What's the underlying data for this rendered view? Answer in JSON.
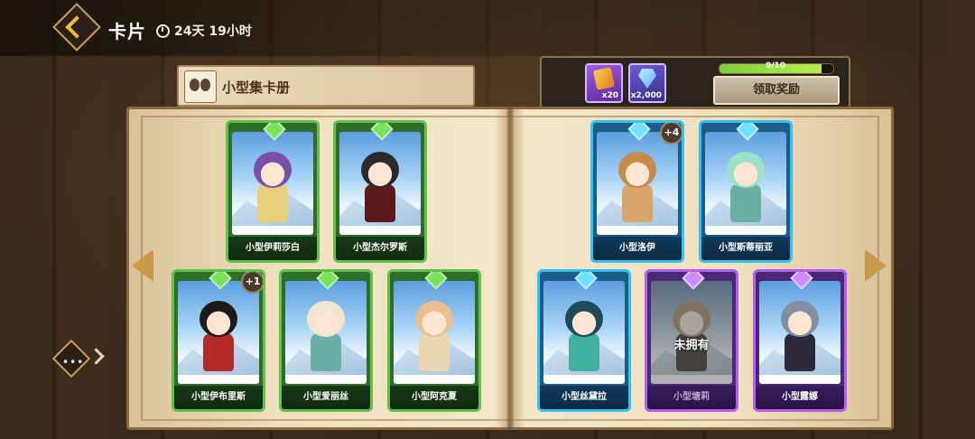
{
  "header": {
    "title": "卡片",
    "timer": "24天 19小时",
    "back_icon": "back-chevron-icon"
  },
  "album": {
    "title": "小型集卡册"
  },
  "rewards": {
    "items": [
      {
        "icon": "gold-scroll-icon",
        "count": "x20"
      },
      {
        "icon": "diamond-icon",
        "count": "x2,000"
      }
    ],
    "progress_text": "9/10",
    "progress": 0.9,
    "claim_label": "领取奖励"
  },
  "cards": [
    {
      "name": "小型伊莉莎白",
      "rarity": "green",
      "badge": ""
    },
    {
      "name": "小型杰尔罗斯",
      "rarity": "green",
      "badge": ""
    },
    {
      "name": "小型洛伊",
      "rarity": "blue",
      "badge": "+4"
    },
    {
      "name": "小型斯蒂丽亚",
      "rarity": "blue",
      "badge": ""
    },
    {
      "name": "小型伊布里斯",
      "rarity": "green",
      "badge": "+1"
    },
    {
      "name": "小型爱丽丝",
      "rarity": "green",
      "badge": ""
    },
    {
      "name": "小型阿克夏",
      "rarity": "green",
      "badge": ""
    },
    {
      "name": "小型丝黛拉",
      "rarity": "blue",
      "badge": ""
    },
    {
      "name": "小型塘莉",
      "rarity": "purple",
      "badge": "",
      "locked_text": "未拥有"
    },
    {
      "name": "小型露娜",
      "rarity": "purple",
      "badge": ""
    }
  ],
  "colors": {
    "green": "#63c04a",
    "blue": "#34c2f0",
    "purple": "#b65ef0",
    "accent": "#f0b440"
  }
}
